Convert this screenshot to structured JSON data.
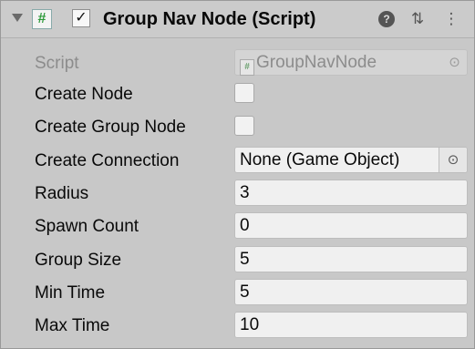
{
  "component": {
    "title": "Group Nav Node (Script)",
    "script_icon": "#",
    "enabled_check": "✓",
    "help_icon": "?",
    "settings_icon": "⇅",
    "menu_icon": "⋮",
    "picker_icon": "⊙"
  },
  "fields": {
    "script": {
      "label": "Script",
      "value": "GroupNavNode",
      "badge": "#"
    },
    "create_node": {
      "label": "Create Node"
    },
    "create_group_node": {
      "label": "Create Group Node"
    },
    "create_connection": {
      "label": "Create Connection",
      "value": "None (Game Object)"
    },
    "radius": {
      "label": "Radius",
      "value": "3"
    },
    "spawn_count": {
      "label": "Spawn Count",
      "value": "0"
    },
    "group_size": {
      "label": "Group Size",
      "value": "5"
    },
    "min_time": {
      "label": "Min Time",
      "value": "5"
    },
    "max_time": {
      "label": "Max Time",
      "value": "10"
    }
  }
}
